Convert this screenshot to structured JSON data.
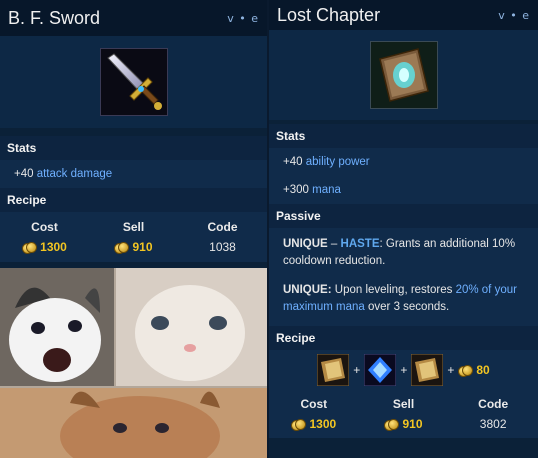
{
  "left": {
    "title": "B. F. Sword",
    "ve": "v • e",
    "stats_header": "Stats",
    "stat_value": "+40",
    "stat_label": "attack damage",
    "recipe_header": "Recipe",
    "cost_label": "Cost",
    "sell_label": "Sell",
    "code_label": "Code",
    "cost": "1300",
    "sell": "910",
    "code": "1038"
  },
  "right": {
    "title": "Lost Chapter",
    "ve": "v • e",
    "stats_header": "Stats",
    "stat1_value": "+40",
    "stat1_label": "ability power",
    "stat2_value": "+300",
    "stat2_label": "mana",
    "passive_header": "Passive",
    "unique1_prefix": "UNIQUE",
    "unique1_dash": " – ",
    "unique1_key": "HASTE",
    "unique1_text": ": Grants an additional 10% cooldown reduction.",
    "unique2_prefix": "UNIQUE:",
    "unique2_text1": " Upon leveling, restores ",
    "unique2_link": "20% of your maximum mana",
    "unique2_text2": " over 3 seconds.",
    "recipe_header": "Recipe",
    "plus": "+",
    "recipe_gold": "80",
    "cost_label": "Cost",
    "sell_label": "Sell",
    "code_label": "Code",
    "cost": "1300",
    "sell": "910",
    "code": "3802"
  },
  "icons": [
    "sword-icon",
    "tome-icon",
    "gem-icon",
    "coin-icon"
  ],
  "colors": {
    "background": "#0b2138",
    "title_bar": "#07172a",
    "link": "#6fb0ff",
    "gold": "#f2c522"
  }
}
